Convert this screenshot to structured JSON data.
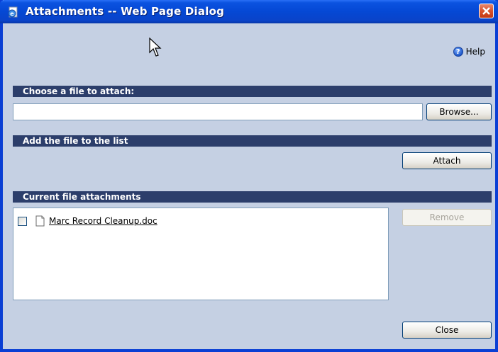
{
  "window": {
    "title": "Attachments -- Web Page Dialog"
  },
  "icons": {
    "title": "ie-page-icon",
    "close": "close-icon",
    "cursor": "mouse-cursor-icon",
    "help": "help-icon",
    "file": "document-icon"
  },
  "help": {
    "label": "Help"
  },
  "choose": {
    "header": "Choose a file to attach:",
    "file_value": "",
    "browse_label": "Browse..."
  },
  "add": {
    "header": "Add the file to the list",
    "attach_label": "Attach"
  },
  "current": {
    "header": "Current file attachments",
    "items": [
      {
        "name": "Marc Record Cleanup.doc",
        "checked": false
      }
    ],
    "remove_label": "Remove"
  },
  "footer": {
    "close_label": "Close"
  },
  "colors": {
    "background": "#c5d0e3",
    "section_bar": "#2c3e6b",
    "titlebar": "#0548d4"
  }
}
